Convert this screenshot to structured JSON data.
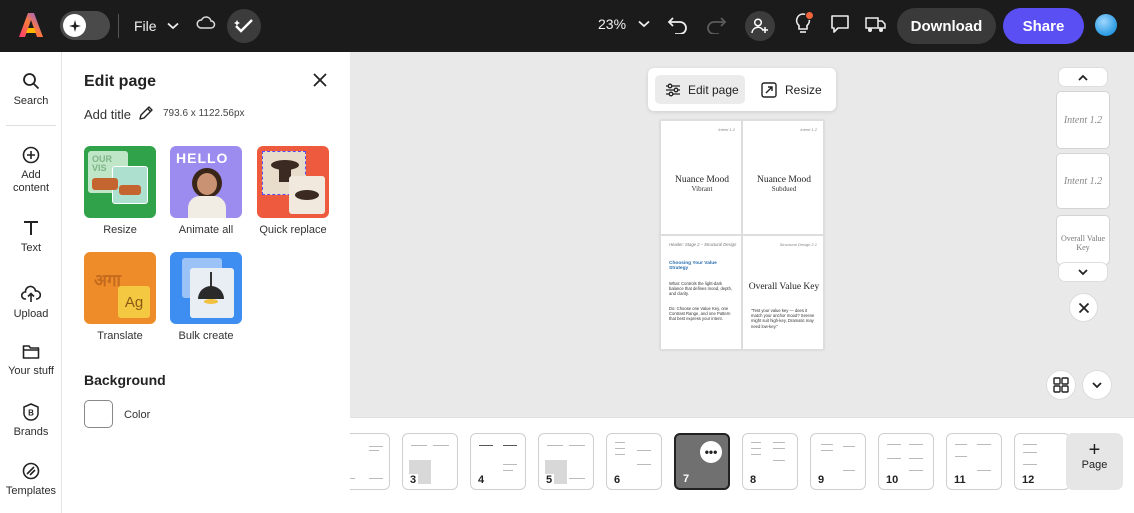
{
  "topbar": {
    "file_label": "File",
    "zoom_label": "23%",
    "download_label": "Download",
    "share_label": "Share"
  },
  "rail": {
    "items": [
      {
        "label": "Search",
        "icon": "search-icon"
      },
      {
        "label": "Add content",
        "icon": "plus-circle-icon"
      },
      {
        "label": "Text",
        "icon": "text-icon"
      },
      {
        "label": "Upload",
        "icon": "upload-icon"
      },
      {
        "label": "Your stuff",
        "icon": "folder-icon"
      },
      {
        "label": "Brands",
        "icon": "brand-icon"
      },
      {
        "label": "Templates",
        "icon": "templates-icon"
      }
    ]
  },
  "panel": {
    "title": "Edit page",
    "add_title": "Add title",
    "dimensions": "793.6 x 1122.56px",
    "tools": [
      {
        "label": "Resize"
      },
      {
        "label": "Animate all"
      },
      {
        "label": "Quick replace"
      },
      {
        "label": "Translate"
      },
      {
        "label": "Bulk create"
      }
    ],
    "background_title": "Background",
    "color_label": "Color"
  },
  "canvas": {
    "edit_page_label": "Edit page",
    "resize_label": "Resize",
    "page": {
      "q1": {
        "tag": "Intent 1.2",
        "title": "Nuance Mood",
        "sub": "Vibrant"
      },
      "q2": {
        "tag": "Intent 1.2",
        "title": "Nuance Mood",
        "sub": "Subdued"
      },
      "q3": {
        "header": "Header: Stage 2 – Structural Design",
        "heading": "Choosing Your Value Strategy",
        "what": "What: Controls the light-dark balance that defines mood, depth, and clarity.",
        "do": "Do: Choose one Value Key, one Contrast Range, and one Pattern that best express your intent."
      },
      "q4": {
        "tag": "Structural Design 2.1",
        "title": "Overall Value Key",
        "body": "\"Test your value key — does it match your anchor mood? Serene might suit high-key, Dramatic may need low-key.\""
      }
    },
    "side_pages": [
      {
        "label": "Intent 1.2"
      },
      {
        "label": "Intent 1.2"
      },
      {
        "label": "Overall Value Key"
      }
    ]
  },
  "strip": {
    "pages": [
      {
        "num": ""
      },
      {
        "num": "3"
      },
      {
        "num": "4"
      },
      {
        "num": "5"
      },
      {
        "num": "6"
      },
      {
        "num": "7"
      },
      {
        "num": "8"
      },
      {
        "num": "9"
      },
      {
        "num": "10"
      },
      {
        "num": "11"
      },
      {
        "num": "12"
      }
    ],
    "add_page_label": "Page",
    "active_index": 5
  }
}
